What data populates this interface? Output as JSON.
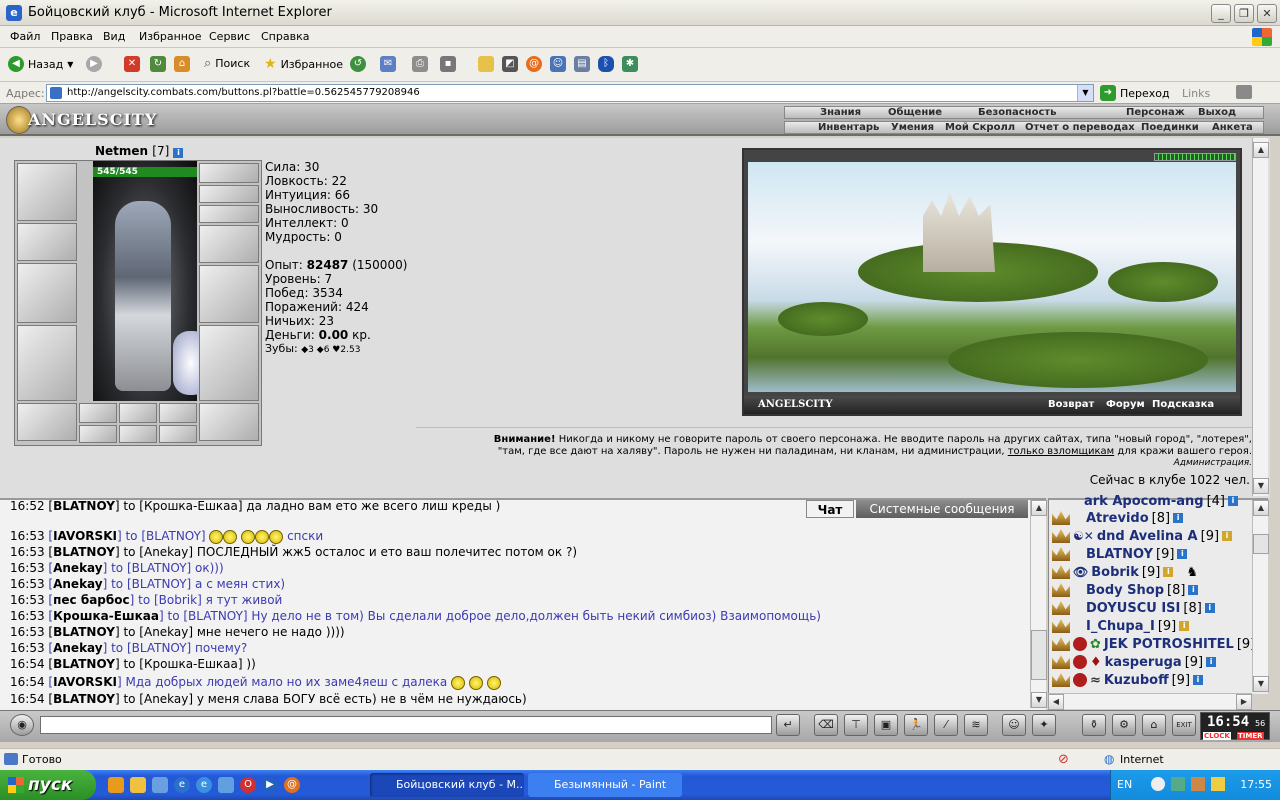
{
  "window": {
    "title": "Бойцовский клуб - Microsoft Internet Explorer"
  },
  "menu": [
    "Файл",
    "Правка",
    "Вид",
    "Избранное",
    "Сервис",
    "Справка"
  ],
  "toolbar": {
    "back": "Назад",
    "search": "Поиск",
    "favorites": "Избранное"
  },
  "address": {
    "label": "Адрес:",
    "url": "http://angelscity.combats.com/buttons.pl?battle=0.562545779208946",
    "go": "Переход",
    "links": "Links"
  },
  "game": {
    "logo": "ANGELSCITY",
    "nav_top": [
      "Знания",
      "Общение",
      "Безопасность",
      "Персонаж",
      "Выход"
    ],
    "nav_bottom": [
      "Инвентарь",
      "Умения",
      "Мой Скролл",
      "Отчет о переводах",
      "Поединки",
      "Анкета"
    ],
    "char": {
      "name": "Netmen",
      "level": "[7]",
      "hp": "545/545"
    },
    "stats": [
      {
        "label": "Сила:",
        "value": "30"
      },
      {
        "label": "Ловкость:",
        "value": "22"
      },
      {
        "label": "Интуиция:",
        "value": "66"
      },
      {
        "label": "Выносливость:",
        "value": "30"
      },
      {
        "label": "Интеллект:",
        "value": "0"
      },
      {
        "label": "Мудрость:",
        "value": "0"
      }
    ],
    "exp": {
      "label": "Опыт:",
      "value": "82487",
      "next": "(150000)"
    },
    "info": [
      {
        "label": "Уровень:",
        "value": "7"
      },
      {
        "label": "Побед:",
        "value": "3534"
      },
      {
        "label": "Поражений:",
        "value": "424"
      },
      {
        "label": "Ничьих:",
        "value": "23"
      }
    ],
    "money": {
      "label": "Деньги:",
      "value": "0.00",
      "unit": "кр."
    },
    "teeth": {
      "label": "Зубы:",
      "v1": "3",
      "v2": "6",
      "v3": "2.53"
    },
    "scene": {
      "caption": "ANGELSCITY",
      "links": [
        "Возврат",
        "Форум",
        "Подсказка"
      ]
    },
    "warning": {
      "bold": "Внимание!",
      "text1": " Никогда и никому не говорите пароль от своего персонажа. Не вводите пароль на других сайтах, типа \"новый город\", \"лотерея\",",
      "text2a": "\"там, где все дают на халяву\". Пароль не нужен ни паладинам, ни кланам, ни администрации, ",
      "link": "только взломщикам",
      "text2b": " для кражи вашего героя.",
      "sign": "Администрация."
    },
    "online": "Сейчас в клубе 1022 чел."
  },
  "chat": {
    "tabs": [
      "Чат",
      "Системные сообщения"
    ],
    "lines": [
      {
        "time": "16:52",
        "nick": "BLATNOY",
        "to": "to [Крошка-Ешкаа]",
        "msg": " да ладно вам ето же всего лиш креды )",
        "color": "#000"
      },
      {
        "time": "16:53",
        "nick": "IAVORSKI",
        "to": "to [BLATNOY]",
        "msg": " спски",
        "color": "#3b3bb3",
        "smiles": true
      },
      {
        "time": "16:53",
        "nick": "BLATNOY",
        "to": "to [Anekay]",
        "msg": " ПОСЛЕДНЫЙ жж5 осталос и ето ваш полечитес потом ок ?)",
        "color": "#000"
      },
      {
        "time": "16:53",
        "nick": "Anekay",
        "to": "to [BLATNOY]",
        "msg": " ок)))",
        "color": "#3b3bb3"
      },
      {
        "time": "16:53",
        "nick": "Anekay",
        "to": "to [BLATNOY]",
        "msg": " а с меян стих)",
        "color": "#3b3bb3"
      },
      {
        "time": "16:53",
        "nick": "пес барбос",
        "to": "to [Bobrik]",
        "msg": " я тут живой",
        "color": "#3b3bb3"
      },
      {
        "time": "16:53",
        "nick": "Крошка-Ешкаа",
        "to": "to [BLATNOY]",
        "msg": " Ну дело не в том) Вы сделали доброе дело,должен быть некий симбиоз) Взаимопомощь)",
        "color": "#3b3bb3"
      },
      {
        "time": "16:53",
        "nick": "BLATNOY",
        "to": "to [Anekay]",
        "msg": " мне нечего не надо ))))",
        "color": "#000"
      },
      {
        "time": "16:53",
        "nick": "Anekay",
        "to": "to [BLATNOY]",
        "msg": " почему?",
        "color": "#3b3bb3"
      },
      {
        "time": "16:54",
        "nick": "BLATNOY",
        "to": "to [Крошка-Ешкаа]",
        "msg": " ))",
        "color": "#000"
      },
      {
        "time": "16:54",
        "nick": "IAVORSKI",
        "to": "",
        "msg": " Мда добрых людей мало но их заме4яеш с далека",
        "color": "#3b3bb3",
        "smiles": true
      },
      {
        "time": "16:54",
        "nick": "BLATNOY",
        "to": "to [Anekay]",
        "msg": " у меня слава БОГУ всё есть) не в чём не нуждаюсь)",
        "color": "#000"
      }
    ]
  },
  "users": [
    {
      "name": "ark Apocom-ang",
      "lvl": "[4]"
    },
    {
      "name": "Atrevido",
      "lvl": "[8]"
    },
    {
      "name": "dnd Avelina A",
      "lvl": "[9]"
    },
    {
      "name": "BLATNOY",
      "lvl": "[9]"
    },
    {
      "name": "Bobrik",
      "lvl": "[9]"
    },
    {
      "name": "Body Shop",
      "lvl": "[8]"
    },
    {
      "name": "DOYUSCU ISI",
      "lvl": "[8]"
    },
    {
      "name": "I_Chupa_I",
      "lvl": "[9]"
    },
    {
      "name": "JEK POTROSHITEL",
      "lvl": "[9]"
    },
    {
      "name": "kasperuga",
      "lvl": "[9]"
    },
    {
      "name": "Kuzuboff",
      "lvl": "[9]"
    }
  ],
  "clock": {
    "time": "16:54",
    "sec": "56",
    "l1": "CLOCK",
    "l2": "TIMER"
  },
  "status": {
    "text": "Готово",
    "zone": "Internet"
  },
  "taskbar": {
    "start": "пуск",
    "tasks": [
      "Бойцовский клуб - М...",
      "Безымянный - Paint"
    ],
    "lang": "EN",
    "time": "17:55"
  }
}
